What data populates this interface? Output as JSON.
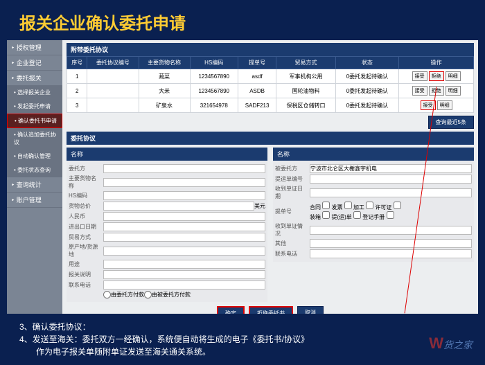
{
  "title": "报关企业确认委托申请",
  "sidebar": {
    "items": [
      {
        "label": "授权管理",
        "sub": false
      },
      {
        "label": "企业登记",
        "sub": false
      },
      {
        "label": "委托报关",
        "sub": false
      },
      {
        "label": "选择报关企业",
        "sub": true
      },
      {
        "label": "发起委托申请",
        "sub": true
      },
      {
        "label": "确认委托书申请",
        "sub": true,
        "hl": true
      },
      {
        "label": "确认追加委托协议",
        "sub": true
      },
      {
        "label": "自动确认管理",
        "sub": true
      },
      {
        "label": "委托状态查询",
        "sub": true
      },
      {
        "label": "查询统计",
        "sub": false
      },
      {
        "label": "账户管理",
        "sub": false
      }
    ]
  },
  "upper_panel": {
    "title": "附带委托协议",
    "headers": [
      "序号",
      "委托协议编号",
      "主要货物名称",
      "HS编码",
      "提单号",
      "贸易方式",
      "状态",
      "操作"
    ],
    "rows": [
      {
        "seq": "1",
        "no": "",
        "goods": "蔬菜",
        "hs": "1234567890",
        "bl": "asdf",
        "trade": "军事机构公用",
        "status": "0委托发起待确认",
        "ops": [
          "接受",
          "拒绝",
          "明细"
        ],
        "hl": 1
      },
      {
        "seq": "2",
        "no": "",
        "goods": "大米",
        "hs": "1234567890",
        "bl": "ASDB",
        "trade": "国轮油物料",
        "status": "0委托发起待确认",
        "ops": [
          "接受",
          "拒绝",
          "明细"
        ],
        "hl": 0
      },
      {
        "seq": "3",
        "no": "",
        "goods": "矿泉水",
        "hs": "321654978",
        "bl": "SADF213",
        "trade": "保税区仓储转口",
        "status": "0委托发起待确认",
        "ops": [
          "接受",
          "明细"
        ],
        "hl": 0,
        "hlAccept": true
      }
    ],
    "toolbar_btn": "查询最近5条"
  },
  "form": {
    "title": "委托协议",
    "left_header": "名称",
    "left_fields": [
      "委托方",
      "主要货物名称",
      "HS编码",
      "货物总价",
      "人民币",
      "进出口日期",
      "贸易方式",
      "原产地/货源地",
      "用途",
      "报关说明",
      "联系电话"
    ],
    "currency_label": "美元",
    "radio1": "由委托方付款",
    "radio2": "由被委托方付款",
    "right_header": "名称",
    "right_value": "宁波市北仑区大榭鑫宇机电",
    "right_fields": [
      "被委托方",
      "提运单编号",
      "收到单证日期",
      "提单号",
      "收到单证情况",
      "其他",
      "联系电话"
    ],
    "r_checks": [
      "合同",
      "发票",
      "加工",
      "许可证"
    ],
    "r_checks2": [
      "装箱",
      "提(运)单",
      "登记手册"
    ]
  },
  "buttons": {
    "ok": "确定",
    "reject": "拒绝委托书",
    "cancel": "取消"
  },
  "footer": {
    "line1": "3、确认委托协议：",
    "line2": "4、发送至海关：委托双方一经确认，系统便自动将生成的电子《委托书/协议》",
    "line3": "作为电子报关单随附单证发送至海关通关系统。"
  },
  "watermark": {
    "w": "W",
    "text": "货之家"
  }
}
